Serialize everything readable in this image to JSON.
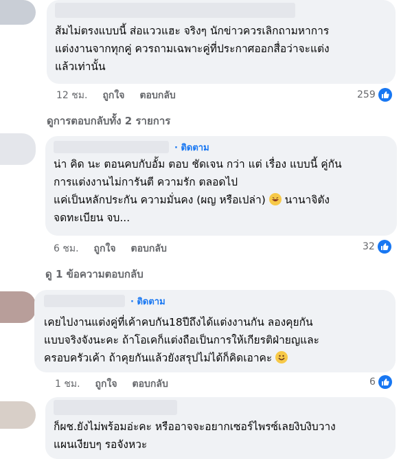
{
  "comments": [
    {
      "text": "ส้มไม่ตรงแบบนี้ ส่อแววแฮะ จริงๆ นักข่าวควรเลิกถามหาการ\nแต่งงานจากทุกคู่ ควรถามเฉพาะคู่ที่ประกาศออกสื่อว่าจะแต่ง\nแล้วเท่านั้น",
      "time": "12 ชม.",
      "like": "ถูกใจ",
      "reply": "ตอบกลับ",
      "reactions": "259",
      "view_replies": "ดูการตอบกลับทั้ง 2 รายการ"
    },
    {
      "follow": "ติดตาม",
      "text_lines": [
        "น่า คิด นะ ตอนคบกับอั้ม ตอบ ชัดเจน กว่า แต่ เรื่อง แบบนี้ คู่กัน",
        "การแต่งงานไม่การันตี ความรัก ตลอดไป"
      ],
      "text_emoji_before": "แค่เป็นหลักประกัน ความมั่นคง (ผญ หรือเปล่า)",
      "text_emoji_after": "นานาจิตัง",
      "text_last": "จดทะเบียน จบ...",
      "time": "6 ชม.",
      "like": "ถูกใจ",
      "reply": "ตอบกลับ",
      "reactions": "32",
      "view_replies": "ดู 1 ข้อความตอบกลับ"
    },
    {
      "follow": "ติดตาม",
      "text_lines": [
        "เคยไปงานแต่งคู่ที่เค้าคบกัน18ปีถึงได้แต่งงานกัน ลองคุยกัน",
        "แบบจริงจังนะคะ ถ้าโอเคก็แต่งถือเป็นการให้เกียรติฝ่ายญและ"
      ],
      "text_emoji_before": "ครอบครัวเค้า ถ้าคุยกันแล้วยังสรุปไม่ได้ก็คิดเอาคะ",
      "time": "1 ชม.",
      "like": "ถูกใจ",
      "reply": "ตอบกลับ",
      "reactions": "6"
    },
    {
      "text": "ก็ผช.ยังไม่พร้อมอ่ะคะ หรืออาจจะอยากเซอร์ไพรซ์เลยงิบงิบวาง\nแผนเงียบๆ รอจังหวะ"
    }
  ],
  "icons": [
    "like-icon",
    "laugh-emoji-icon",
    "smile-emoji-icon",
    "reply-arrow-icon"
  ],
  "colors": {
    "link": "#1877f2",
    "bubble": "#f0f2f5",
    "muted": "#65676b"
  }
}
